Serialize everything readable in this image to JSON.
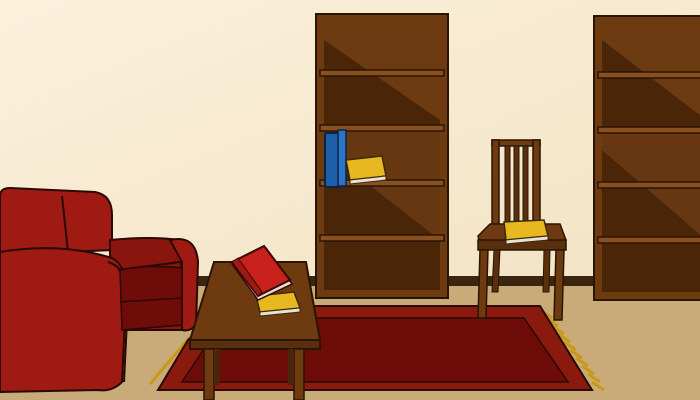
{
  "scene": {
    "colors": {
      "wall": "#f6e8cd",
      "floor": "#c9ab79",
      "baseboard": "#3a2510",
      "wood": "#6e3a10",
      "wood_dark": "#4a2508",
      "wood_light": "#8a4f1e",
      "sofa": "#9e1a12",
      "sofa_dark": "#6d0c08",
      "rug": "#8a1a0e",
      "rug_inner": "#6d0c08",
      "fringe": "#c89a18",
      "book_red": "#c8201a",
      "book_blue": "#1f5fa8",
      "book_yellow": "#e8b820",
      "paper": "#e8e2d6"
    },
    "objects": [
      {
        "name": "sofa",
        "icon": "sofa-icon"
      },
      {
        "name": "coffee-table",
        "icon": "table-icon"
      },
      {
        "name": "red-book",
        "icon": "book-icon"
      },
      {
        "name": "yellow-notebook-on-table",
        "icon": "notebook-icon"
      },
      {
        "name": "blue-book",
        "icon": "book-icon"
      },
      {
        "name": "yellow-notebook-on-shelf",
        "icon": "notebook-icon"
      },
      {
        "name": "yellow-notebook-on-chair",
        "icon": "notebook-icon"
      },
      {
        "name": "wooden-chair",
        "icon": "chair-icon"
      },
      {
        "name": "bookshelf-center",
        "icon": "bookshelf-icon"
      },
      {
        "name": "bookshelf-right",
        "icon": "bookshelf-icon"
      },
      {
        "name": "rug",
        "icon": "rug-icon"
      }
    ]
  }
}
